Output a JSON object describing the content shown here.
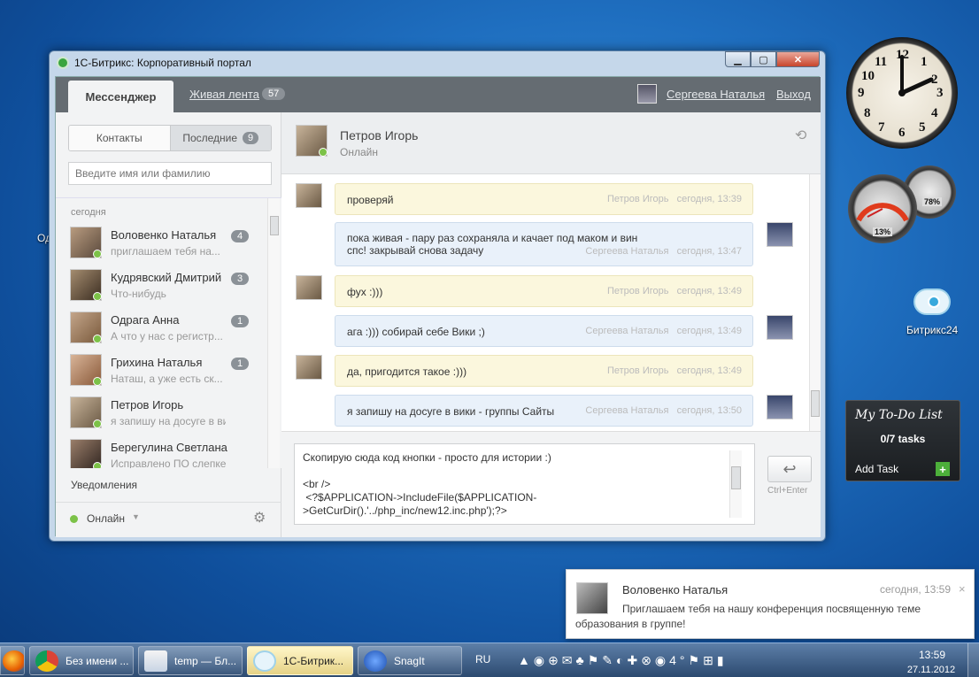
{
  "window": {
    "title": "1С-Битрикс: Корпоративный портал",
    "min": "▁",
    "max": "▢",
    "close": "✕"
  },
  "nav": {
    "messenger": "Мессенджер",
    "feed": "Живая лента",
    "feed_count": "57",
    "user": "Сергеева Наталья",
    "logout": "Выход"
  },
  "left": {
    "contacts_tab": "Контакты",
    "recent_tab": "Последние",
    "recent_count": "9",
    "search_placeholder": "Введите имя или фамилию",
    "day": "сегодня",
    "items": [
      {
        "name": "Воловенко Наталья",
        "msg": "приглашаем тебя на...",
        "count": "4"
      },
      {
        "name": "Кудрявский Дмитрий",
        "msg": "Что-нибудь",
        "count": "3"
      },
      {
        "name": "Одрага Анна",
        "msg": "А что у нас с регистр...",
        "count": "1"
      },
      {
        "name": "Грихина Наталья",
        "msg": "Наташ, а уже есть ск...",
        "count": "1"
      },
      {
        "name": "Петров Игорь",
        "msg": "я запишу на досуге в вик...",
        "count": ""
      },
      {
        "name": "Берегулина Светлана",
        "msg": "Исправлено ПО слепке -",
        "count": ""
      }
    ],
    "notifications": "Уведомления",
    "status": "Онлайн"
  },
  "chat": {
    "peer_name": "Петров Игорь",
    "peer_status": "Онлайн",
    "messages": [
      {
        "text": "проверяй",
        "text2": "",
        "author": "Петров Игорь",
        "time": "сегодня, 13:39"
      },
      {
        "text": "пока живая - пару раз сохраняла и качает под маком и вин",
        "text2": "спс! закрывай снова задачу",
        "author": "Сергеева Наталья",
        "time": "сегодня, 13:47"
      },
      {
        "text": "фух :)))",
        "text2": "",
        "author": "Петров Игорь",
        "time": "сегодня, 13:49"
      },
      {
        "text": "ага :))) собирай себе Вики ;)",
        "text2": "",
        "author": "Сергеева Наталья",
        "time": "сегодня, 13:49"
      },
      {
        "text": "да, пригодится такое :)))",
        "text2": "",
        "author": "Петров Игорь",
        "time": "сегодня, 13:49"
      },
      {
        "text": "я запишу на досуге в вики - группы Сайты",
        "text2": "",
        "author": "Сергеева Наталья",
        "time": "сегодня, 13:50"
      }
    ],
    "input_value": "Скопирую сюда код кнопки - просто для истории :)\n\n<br />\n <?$APPLICATION->IncludeFile($APPLICATION->GetCurDir().'../php_inc/new12.inc.php');?>",
    "send_icon": "↩",
    "send_hint": "Ctrl+Enter"
  },
  "desktop": {
    "clock_numbers": [
      "12",
      "1",
      "2",
      "3",
      "4",
      "5",
      "6",
      "7",
      "8",
      "9",
      "10",
      "11"
    ],
    "cpu_label": "13%",
    "mem_label": "78%",
    "b24_label": "Битрикс24",
    "partial_label": "Од",
    "todo_title": "My To-Do List",
    "todo_count": "0/7 tasks",
    "todo_add": "Add Task",
    "todo_plus": "+"
  },
  "toast": {
    "name": "Воловенко Наталья",
    "time": "сегодня, 13:59",
    "close": "×",
    "text": "Приглашаем тебя на нашу конференция посвященную теме",
    "text2": "образования в группе!"
  },
  "taskbar": {
    "items": [
      "Без имени ...",
      "temp — Бл...",
      "1С-Битрик...",
      "SnagIt"
    ],
    "lang": "RU",
    "tray_temp": "4°",
    "time": "13:59",
    "date": "27.11.2012"
  },
  "colors": {
    "accent_green": "#7cc248",
    "nav_dark": "#656c72",
    "in_bubble": "#fbf7dd",
    "out_bubble": "#e9f1fa"
  }
}
